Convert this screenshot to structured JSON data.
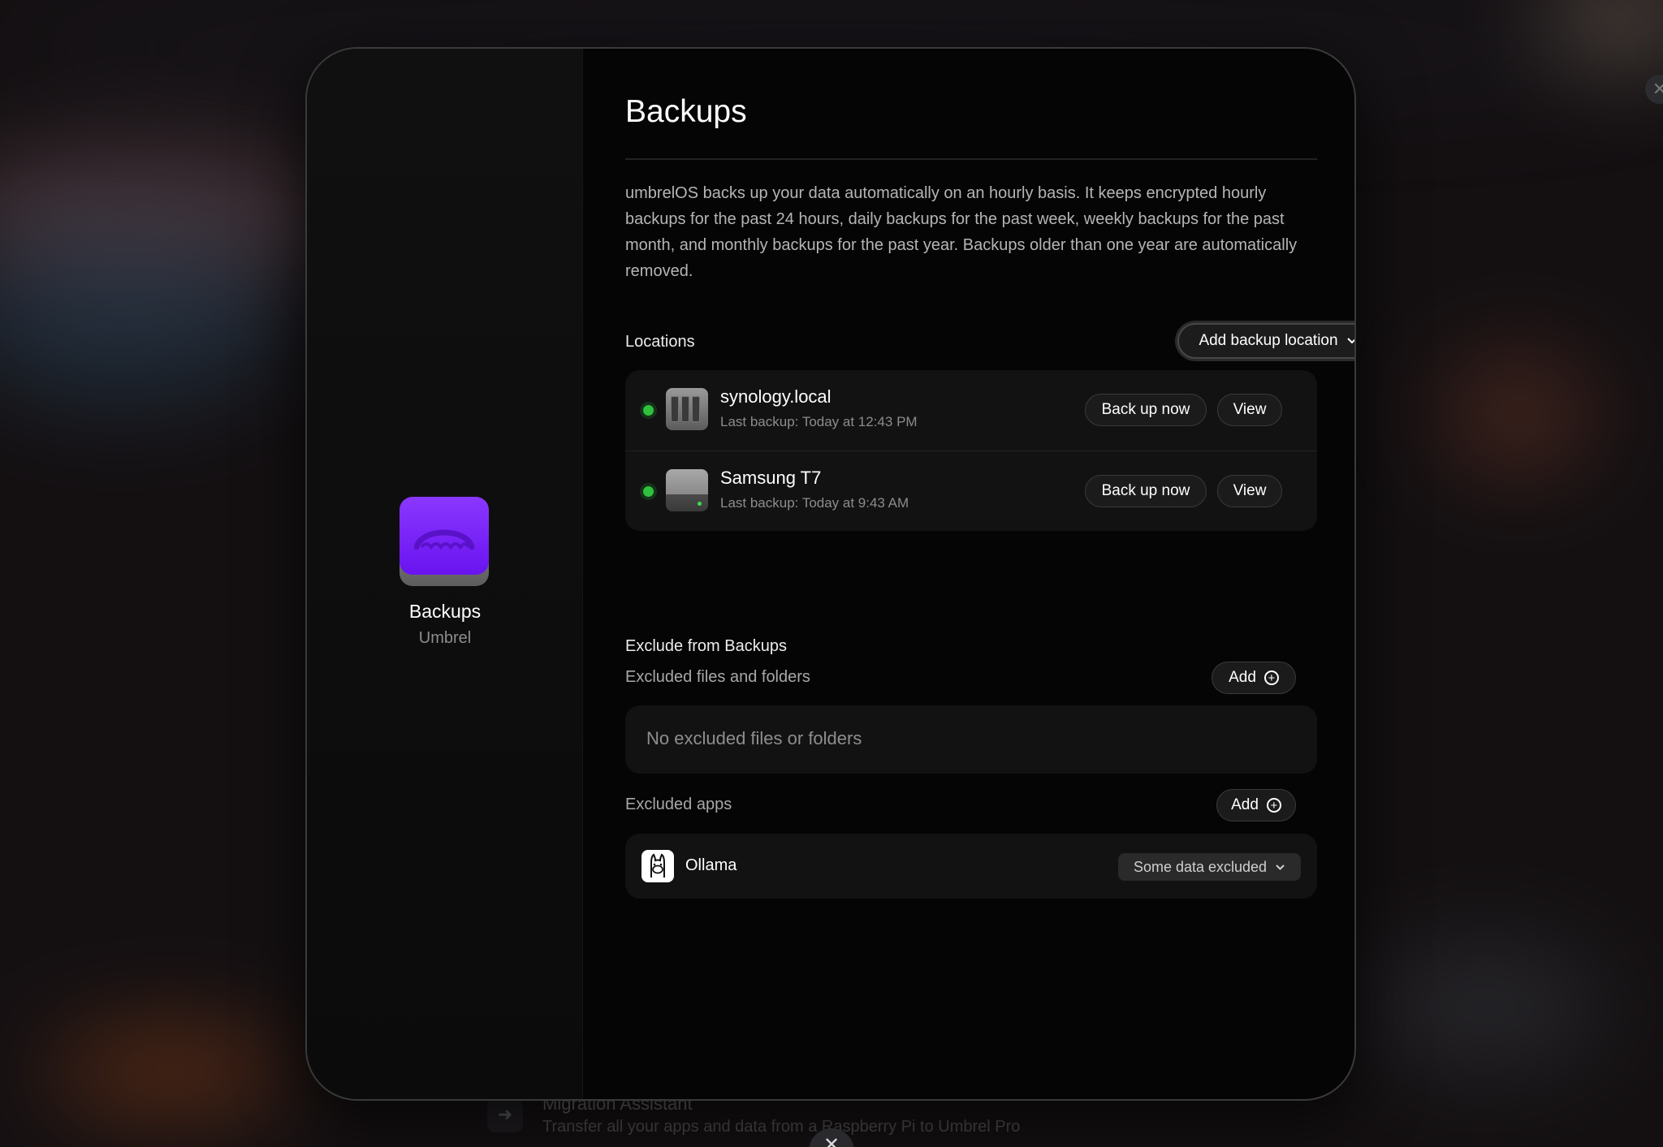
{
  "background": {
    "migration_title": "Migration Assistant",
    "migration_subtitle": "Transfer all your apps and data from a Raspberry Pi to Umbrel Pro",
    "close_glyph": "✕"
  },
  "sidebar": {
    "app_name": "Backups",
    "app_developer": "Umbrel",
    "app_icon": "umbrel-logo-icon"
  },
  "main": {
    "title": "Backups",
    "description": "umbrelOS backs up your data automatically on an hourly basis. It keeps encrypted hourly backups for the past 24 hours, daily backups for the past week, weekly backups for the past month, and monthly backups for the past year. Backups older than one year are automatically removed.",
    "locations": {
      "label": "Locations",
      "add_button_label": "Add backup location",
      "items": [
        {
          "name": "synology.local",
          "last_backup": "Last backup: Today at 12:43 PM",
          "icon": "nas-icon",
          "backup_label": "Back up now",
          "view_label": "View",
          "status_color": "#2fc13e"
        },
        {
          "name": "Samsung T7",
          "last_backup": "Last backup: Today at 9:43 AM",
          "icon": "external-drive-icon",
          "backup_label": "Back up now",
          "view_label": "View",
          "status_color": "#2fc13e"
        }
      ]
    },
    "exclude": {
      "heading": "Exclude from Backups",
      "files_label": "Excluded files and folders",
      "files_add_label": "Add",
      "files_empty": "No excluded files or folders",
      "apps_label": "Excluded apps",
      "apps_add_label": "Add",
      "apps": [
        {
          "name": "Ollama",
          "icon": "ollama-llama-icon",
          "exclusion_label": "Some data excluded"
        }
      ]
    }
  },
  "colors": {
    "accent_purple": "#7a2cff",
    "status_green": "#2fc13e",
    "panel_bg": "#121212"
  }
}
